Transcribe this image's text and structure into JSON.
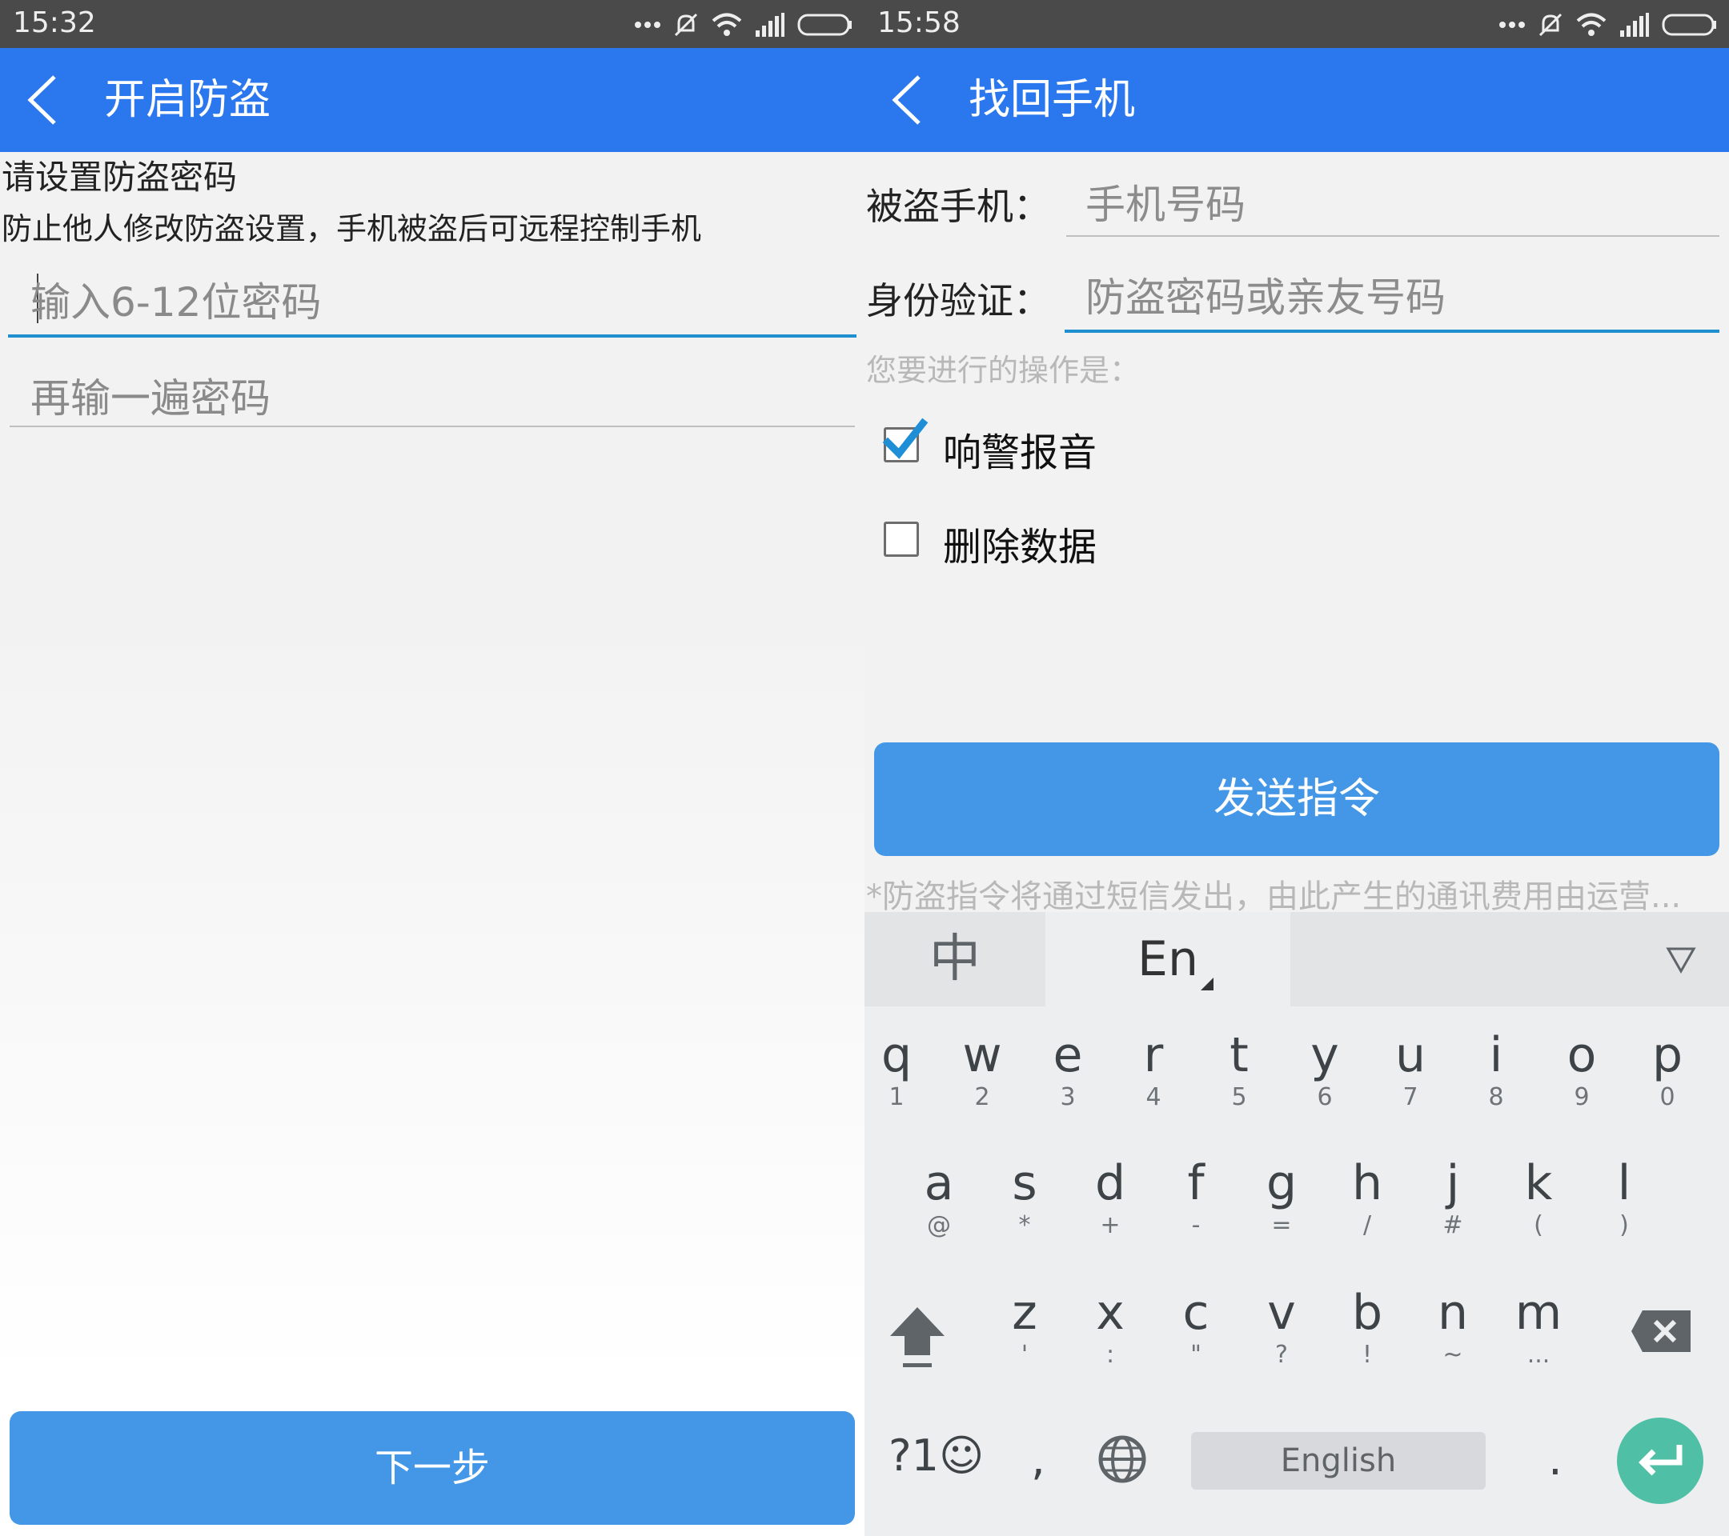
{
  "left": {
    "status": {
      "time": "15:32"
    },
    "appbar": {
      "title": "开启防盗"
    },
    "heading": "请设置防盗密码",
    "description": "防止他人修改防盗设置，手机被盗后可远程控制手机",
    "password_input": {
      "placeholder": "输入6-12位密码",
      "value": ""
    },
    "confirm_input": {
      "placeholder": "再输一遍密码",
      "value": ""
    },
    "next_button": "下一步"
  },
  "right": {
    "status": {
      "time": "15:58"
    },
    "appbar": {
      "title": "找回手机"
    },
    "phone_field": {
      "label": "被盗手机：",
      "placeholder": "手机号码",
      "value": ""
    },
    "verify_field": {
      "label": "身份验证：",
      "placeholder": "防盗密码或亲友号码",
      "value": ""
    },
    "operation_prompt": "您要进行的操作是：",
    "options": [
      {
        "label": "响警报音",
        "checked": true
      },
      {
        "label": "删除数据",
        "checked": false
      }
    ],
    "send_button": "发送指令",
    "notice": "*防盗指令将通过短信发出，由此产生的通讯费用由运营...",
    "keyboard": {
      "tabs": [
        "中",
        "En"
      ],
      "row1": [
        {
          "k": "q",
          "s": "1"
        },
        {
          "k": "w",
          "s": "2"
        },
        {
          "k": "e",
          "s": "3"
        },
        {
          "k": "r",
          "s": "4"
        },
        {
          "k": "t",
          "s": "5"
        },
        {
          "k": "y",
          "s": "6"
        },
        {
          "k": "u",
          "s": "7"
        },
        {
          "k": "i",
          "s": "8"
        },
        {
          "k": "o",
          "s": "9"
        },
        {
          "k": "p",
          "s": "0"
        }
      ],
      "row2": [
        {
          "k": "a",
          "s": "@"
        },
        {
          "k": "s",
          "s": "*"
        },
        {
          "k": "d",
          "s": "+"
        },
        {
          "k": "f",
          "s": "-"
        },
        {
          "k": "g",
          "s": "="
        },
        {
          "k": "h",
          "s": "/"
        },
        {
          "k": "j",
          "s": "#"
        },
        {
          "k": "k",
          "s": "("
        },
        {
          "k": "l",
          "s": ")"
        }
      ],
      "row3": [
        {
          "k": "z",
          "s": "'"
        },
        {
          "k": "x",
          "s": ":"
        },
        {
          "k": "c",
          "s": "\""
        },
        {
          "k": "v",
          "s": "?"
        },
        {
          "k": "b",
          "s": "!"
        },
        {
          "k": "n",
          "s": "~"
        },
        {
          "k": "m",
          "s": "..."
        }
      ],
      "symbols_key": "?1☺",
      "comma_key": ",",
      "space_label": "English",
      "period_key": "."
    }
  },
  "colors": {
    "appbar": "#2b78ee",
    "button": "#4497e6",
    "focus_line": "#1f8fd0",
    "checkbox_check": "#1e8fd6",
    "enter_key": "#4fbfa5"
  },
  "icons": [
    "back-arrow-icon",
    "more-dots-icon",
    "mute-icon",
    "wifi-icon",
    "signal-icon",
    "battery-icon",
    "checkmark-icon",
    "dropdown-triangle-icon",
    "shift-icon",
    "backspace-icon",
    "globe-icon",
    "enter-icon"
  ]
}
